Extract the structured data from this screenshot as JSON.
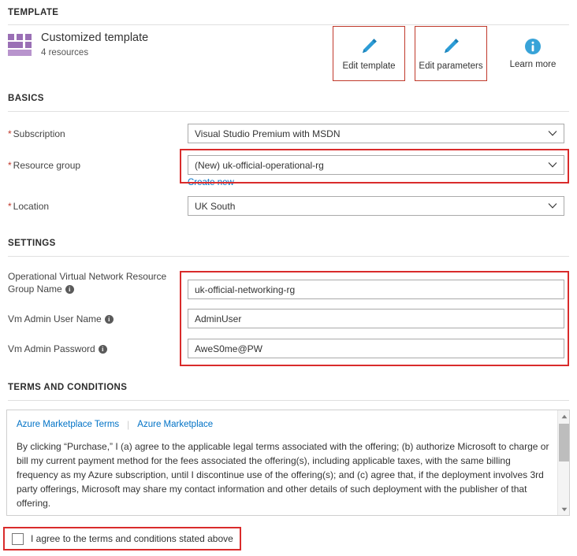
{
  "sections": {
    "template_heading": "TEMPLATE",
    "basics_heading": "BASICS",
    "settings_heading": "SETTINGS",
    "terms_heading": "TERMS AND CONDITIONS"
  },
  "template": {
    "name": "Customized template",
    "resources": "4 resources",
    "icon": "template-grid-icon",
    "actions": [
      {
        "label": "Edit template",
        "icon": "pencil-icon",
        "highlighted": true
      },
      {
        "label": "Edit parameters",
        "icon": "pencil-icon",
        "highlighted": true
      },
      {
        "label": "Learn more",
        "icon": "info-circle-icon",
        "highlighted": false
      }
    ]
  },
  "basics": {
    "subscription": {
      "label": "Subscription",
      "required": true,
      "value": "Visual Studio Premium with MSDN"
    },
    "resource_group": {
      "label": "Resource group",
      "required": true,
      "value": "(New) uk-official-operational-rg",
      "create_new_link": "Create new",
      "highlighted": true
    },
    "location": {
      "label": "Location",
      "required": true,
      "value": "UK South"
    }
  },
  "settings": {
    "highlighted": true,
    "fields": [
      {
        "label": "Operational Virtual Network Resource Group Name",
        "has_info": true,
        "value": "uk-official-networking-rg"
      },
      {
        "label": "Vm Admin User Name",
        "has_info": true,
        "value": "AdminUser"
      },
      {
        "label": "Vm Admin Password",
        "has_info": true,
        "value": "AweS0me@PW"
      }
    ]
  },
  "terms": {
    "links": [
      "Azure Marketplace Terms",
      "Azure Marketplace"
    ],
    "separator": "|",
    "body": "By clicking “Purchase,” I (a) agree to the applicable legal terms associated with the offering; (b) authorize Microsoft to charge or bill my current payment method for the fees associated the offering(s), including applicable taxes, with the same billing frequency as my Azure subscription, until I discontinue use of the offering(s); and (c) agree that, if the deployment involves 3rd party offerings, Microsoft may share my contact information and other details of such deployment with the publisher of that offering."
  },
  "agreement": {
    "label": "I agree to the terms and conditions stated above",
    "checked": false,
    "highlighted": true
  },
  "colors": {
    "highlight_red": "#d92b2b",
    "link_blue": "#0072c6",
    "accent_purple": "#9a6fb5",
    "required_asterisk": "#c0392b"
  }
}
